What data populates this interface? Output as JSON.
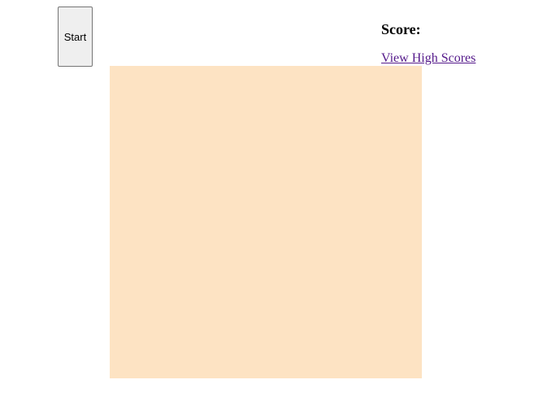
{
  "controls": {
    "start_label": "Start"
  },
  "score": {
    "label": "Score:",
    "value": ""
  },
  "links": {
    "high_scores": "View High Scores"
  },
  "board": {
    "background_color": "#fde3c3"
  },
  "colors": {
    "link_visited": "#551a8b",
    "button_bg": "#efefef"
  }
}
